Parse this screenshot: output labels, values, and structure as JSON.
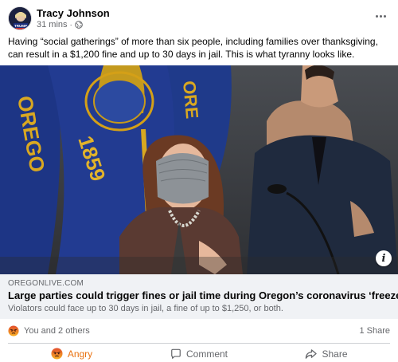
{
  "post": {
    "author": "Tracy Johnson",
    "time": "31 mins",
    "separator": "·",
    "avatar_badge": "TRUMP",
    "text": "Having “social gatherings” of more than six people, including families over thanksgiving, can result in a $1,200 fine and up to 30 days in jail. This is what tyranny looks like."
  },
  "link": {
    "domain": "OREGONLIVE.COM",
    "title": "Large parties could trigger fines or jail time during Oregon’s coronavirus ‘freeze’",
    "description": "Violators could face up to 30 days in jail, a fine of up to $1,250, or both."
  },
  "photo": {
    "flag_left_text": "OREGO",
    "flag_seal_text": "1859",
    "flag_right_text": "ORE"
  },
  "reactions": {
    "summary": "You and 2 others",
    "shares": "1 Share"
  },
  "actions": {
    "angry": "Angry",
    "comment": "Comment",
    "share": "Share"
  },
  "colors": {
    "angry": "#e9710f",
    "flag_blue": "#1f3a8a",
    "flag_gold": "#d4a017"
  },
  "icons": {
    "more": "more-options-icon",
    "globe": "globe-icon",
    "info": "info-icon",
    "angry": "angry-reaction-icon",
    "comment": "comment-icon",
    "share": "share-icon"
  }
}
